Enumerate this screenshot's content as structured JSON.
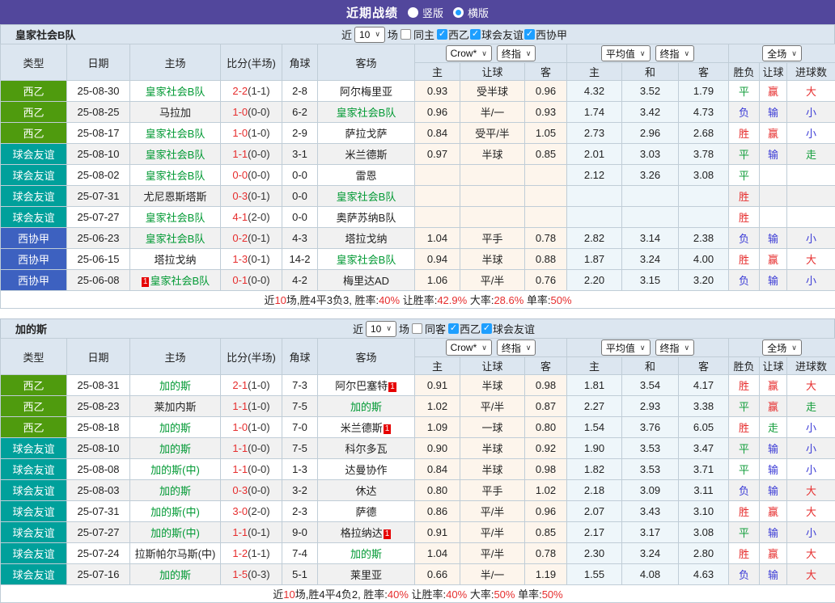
{
  "title": {
    "text": "近期战绩",
    "options": [
      {
        "label": "竖版",
        "checked": false
      },
      {
        "label": "横版",
        "checked": true
      }
    ]
  },
  "columns": {
    "type": "类型",
    "date": "日期",
    "home": "主场",
    "score": "比分(半场)",
    "corner": "角球",
    "away": "客场",
    "h": "主",
    "handicap": "让球",
    "a": "客",
    "draw": "和",
    "wl": "胜负",
    "goals": "进球数"
  },
  "dropdowns": {
    "odds_src": "Crow*",
    "final": "终指",
    "avg": "平均值",
    "scope": "全场"
  },
  "filter_words": {
    "near": "近",
    "count": "10",
    "games": "场"
  },
  "colors": {
    "topbar": "#52479c",
    "league_green": "#4f9b0e",
    "league_teal": "#00a09b",
    "league_blue": "#3d61c0",
    "team_highlight": "#009933",
    "score_red": "#e62e2e",
    "check_blue": "#1e9fff"
  },
  "tables": [
    {
      "team": "皇家社会B队",
      "same": {
        "label": "同主",
        "checked": false
      },
      "leagues": [
        {
          "label": "西乙",
          "checked": true
        },
        {
          "label": "球会友谊",
          "checked": true
        },
        {
          "label": "西协甲",
          "checked": true
        }
      ],
      "rows": [
        {
          "lg": "西乙",
          "lc": "g",
          "date": "25-08-30",
          "home": {
            "n": "皇家社会B队",
            "g": true
          },
          "score": "2-2",
          "half": "(1-1)",
          "corner": "2-8",
          "away": {
            "n": "阿尔梅里亚"
          },
          "odds": [
            "0.93",
            "受半球",
            "0.96"
          ],
          "avg": [
            "4.32",
            "3.52",
            "1.79"
          ],
          "res": [
            [
              "平",
              "g"
            ],
            [
              "赢",
              "r"
            ],
            [
              "大",
              "r"
            ]
          ]
        },
        {
          "lg": "西乙",
          "lc": "g",
          "date": "25-08-25",
          "home": {
            "n": "马拉加"
          },
          "score": "1-0",
          "half": "(0-0)",
          "corner": "6-2",
          "away": {
            "n": "皇家社会B队",
            "g": true
          },
          "odds": [
            "0.96",
            "半/一",
            "0.93"
          ],
          "avg": [
            "1.74",
            "3.42",
            "4.73"
          ],
          "res": [
            [
              "负",
              "b"
            ],
            [
              "输",
              "b"
            ],
            [
              "小",
              "b"
            ]
          ]
        },
        {
          "lg": "西乙",
          "lc": "g",
          "date": "25-08-17",
          "home": {
            "n": "皇家社会B队",
            "g": true
          },
          "score": "1-0",
          "half": "(1-0)",
          "corner": "2-9",
          "away": {
            "n": "萨拉戈萨"
          },
          "odds": [
            "0.84",
            "受平/半",
            "1.05"
          ],
          "avg": [
            "2.73",
            "2.96",
            "2.68"
          ],
          "res": [
            [
              "胜",
              "r"
            ],
            [
              "赢",
              "r"
            ],
            [
              "小",
              "b"
            ]
          ]
        },
        {
          "lg": "球会友谊",
          "lc": "t",
          "date": "25-08-10",
          "home": {
            "n": "皇家社会B队",
            "g": true
          },
          "score": "1-1",
          "half": "(0-0)",
          "corner": "3-1",
          "away": {
            "n": "米兰德斯"
          },
          "odds": [
            "0.97",
            "半球",
            "0.85"
          ],
          "avg": [
            "2.01",
            "3.03",
            "3.78"
          ],
          "res": [
            [
              "平",
              "g"
            ],
            [
              "输",
              "b"
            ],
            [
              "走",
              "g"
            ]
          ]
        },
        {
          "lg": "球会友谊",
          "lc": "t",
          "date": "25-08-02",
          "home": {
            "n": "皇家社会B队",
            "g": true
          },
          "score": "0-0",
          "half": "(0-0)",
          "corner": "0-0",
          "away": {
            "n": "雷恩"
          },
          "odds": [
            "",
            "",
            ""
          ],
          "avg": [
            "2.12",
            "3.26",
            "3.08"
          ],
          "res": [
            [
              "平",
              "g"
            ],
            [
              "",
              ""
            ],
            [
              "",
              ""
            ]
          ]
        },
        {
          "lg": "球会友谊",
          "lc": "t",
          "date": "25-07-31",
          "home": {
            "n": "尤尼恩斯塔斯"
          },
          "score": "0-3",
          "half": "(0-1)",
          "corner": "0-0",
          "away": {
            "n": "皇家社会B队",
            "g": true
          },
          "odds": [
            "",
            "",
            ""
          ],
          "avg": [
            "",
            "",
            ""
          ],
          "res": [
            [
              "胜",
              "r"
            ],
            [
              "",
              ""
            ],
            [
              "",
              ""
            ]
          ]
        },
        {
          "lg": "球会友谊",
          "lc": "t",
          "date": "25-07-27",
          "home": {
            "n": "皇家社会B队",
            "g": true
          },
          "score": "4-1",
          "half": "(2-0)",
          "corner": "0-0",
          "away": {
            "n": "奥萨苏纳B队"
          },
          "odds": [
            "",
            "",
            ""
          ],
          "avg": [
            "",
            "",
            ""
          ],
          "res": [
            [
              "胜",
              "r"
            ],
            [
              "",
              ""
            ],
            [
              "",
              ""
            ]
          ]
        },
        {
          "lg": "西协甲",
          "lc": "b",
          "date": "25-06-23",
          "home": {
            "n": "皇家社会B队",
            "g": true
          },
          "score": "0-2",
          "half": "(0-1)",
          "corner": "4-3",
          "away": {
            "n": "塔拉戈纳"
          },
          "odds": [
            "1.04",
            "平手",
            "0.78"
          ],
          "avg": [
            "2.82",
            "3.14",
            "2.38"
          ],
          "res": [
            [
              "负",
              "b"
            ],
            [
              "输",
              "b"
            ],
            [
              "小",
              "b"
            ]
          ]
        },
        {
          "lg": "西协甲",
          "lc": "b",
          "date": "25-06-15",
          "home": {
            "n": "塔拉戈纳"
          },
          "score": "1-3",
          "half": "(0-1)",
          "corner": "14-2",
          "away": {
            "n": "皇家社会B队",
            "g": true
          },
          "odds": [
            "0.94",
            "半球",
            "0.88"
          ],
          "avg": [
            "1.87",
            "3.24",
            "4.00"
          ],
          "res": [
            [
              "胜",
              "r"
            ],
            [
              "赢",
              "r"
            ],
            [
              "大",
              "r"
            ]
          ]
        },
        {
          "lg": "西协甲",
          "lc": "b",
          "date": "25-06-08",
          "home": {
            "n": "皇家社会B队",
            "g": true,
            "rc": "pre"
          },
          "score": "0-1",
          "half": "(0-0)",
          "corner": "4-2",
          "away": {
            "n": "梅里达AD"
          },
          "odds": [
            "1.06",
            "平/半",
            "0.76"
          ],
          "avg": [
            "2.20",
            "3.15",
            "3.20"
          ],
          "res": [
            [
              "负",
              "b"
            ],
            [
              "输",
              "b"
            ],
            [
              "小",
              "b"
            ]
          ]
        }
      ],
      "summary": [
        [
          "近",
          "k"
        ],
        [
          "10",
          "r"
        ],
        [
          "场,胜4平3负3, 胜率:",
          "k"
        ],
        [
          "40%",
          "r"
        ],
        [
          " 让胜率:",
          "k"
        ],
        [
          "42.9%",
          "r"
        ],
        [
          " 大率:",
          "k"
        ],
        [
          "28.6%",
          "r"
        ],
        [
          " 单率:",
          "k"
        ],
        [
          "50%",
          "r"
        ]
      ]
    },
    {
      "team": "加的斯",
      "same": {
        "label": "同客",
        "checked": false
      },
      "leagues": [
        {
          "label": "西乙",
          "checked": true
        },
        {
          "label": "球会友谊",
          "checked": true
        }
      ],
      "rows": [
        {
          "lg": "西乙",
          "lc": "g",
          "date": "25-08-31",
          "home": {
            "n": "加的斯",
            "g": true
          },
          "score": "2-1",
          "half": "(1-0)",
          "corner": "7-3",
          "away": {
            "n": "阿尔巴塞特",
            "rc": "post"
          },
          "odds": [
            "0.91",
            "半球",
            "0.98"
          ],
          "avg": [
            "1.81",
            "3.54",
            "4.17"
          ],
          "res": [
            [
              "胜",
              "r"
            ],
            [
              "赢",
              "r"
            ],
            [
              "大",
              "r"
            ]
          ]
        },
        {
          "lg": "西乙",
          "lc": "g",
          "date": "25-08-23",
          "home": {
            "n": "莱加内斯"
          },
          "score": "1-1",
          "half": "(1-0)",
          "corner": "7-5",
          "away": {
            "n": "加的斯",
            "g": true
          },
          "odds": [
            "1.02",
            "平/半",
            "0.87"
          ],
          "avg": [
            "2.27",
            "2.93",
            "3.38"
          ],
          "res": [
            [
              "平",
              "g"
            ],
            [
              "赢",
              "r"
            ],
            [
              "走",
              "g"
            ]
          ]
        },
        {
          "lg": "西乙",
          "lc": "g",
          "date": "25-08-18",
          "home": {
            "n": "加的斯",
            "g": true
          },
          "score": "1-0",
          "half": "(1-0)",
          "corner": "7-0",
          "away": {
            "n": "米兰德斯",
            "rc": "post"
          },
          "odds": [
            "1.09",
            "一球",
            "0.80"
          ],
          "avg": [
            "1.54",
            "3.76",
            "6.05"
          ],
          "res": [
            [
              "胜",
              "r"
            ],
            [
              "走",
              "g"
            ],
            [
              "小",
              "b"
            ]
          ]
        },
        {
          "lg": "球会友谊",
          "lc": "t",
          "date": "25-08-10",
          "home": {
            "n": "加的斯",
            "g": true
          },
          "score": "1-1",
          "half": "(0-0)",
          "corner": "7-5",
          "away": {
            "n": "科尔多瓦"
          },
          "odds": [
            "0.90",
            "半球",
            "0.92"
          ],
          "avg": [
            "1.90",
            "3.53",
            "3.47"
          ],
          "res": [
            [
              "平",
              "g"
            ],
            [
              "输",
              "b"
            ],
            [
              "小",
              "b"
            ]
          ]
        },
        {
          "lg": "球会友谊",
          "lc": "t",
          "date": "25-08-08",
          "home": {
            "n": "加的斯(中)",
            "g": true
          },
          "score": "1-1",
          "half": "(0-0)",
          "corner": "1-3",
          "away": {
            "n": "达曼协作"
          },
          "odds": [
            "0.84",
            "半球",
            "0.98"
          ],
          "avg": [
            "1.82",
            "3.53",
            "3.71"
          ],
          "res": [
            [
              "平",
              "g"
            ],
            [
              "输",
              "b"
            ],
            [
              "小",
              "b"
            ]
          ]
        },
        {
          "lg": "球会友谊",
          "lc": "t",
          "date": "25-08-03",
          "home": {
            "n": "加的斯",
            "g": true
          },
          "score": "0-3",
          "half": "(0-0)",
          "corner": "3-2",
          "away": {
            "n": "休达"
          },
          "odds": [
            "0.80",
            "平手",
            "1.02"
          ],
          "avg": [
            "2.18",
            "3.09",
            "3.11"
          ],
          "res": [
            [
              "负",
              "b"
            ],
            [
              "输",
              "b"
            ],
            [
              "大",
              "r"
            ]
          ]
        },
        {
          "lg": "球会友谊",
          "lc": "t",
          "date": "25-07-31",
          "home": {
            "n": "加的斯(中)",
            "g": true
          },
          "score": "3-0",
          "half": "(2-0)",
          "corner": "2-3",
          "away": {
            "n": "萨德"
          },
          "odds": [
            "0.86",
            "平/半",
            "0.96"
          ],
          "avg": [
            "2.07",
            "3.43",
            "3.10"
          ],
          "res": [
            [
              "胜",
              "r"
            ],
            [
              "赢",
              "r"
            ],
            [
              "大",
              "r"
            ]
          ]
        },
        {
          "lg": "球会友谊",
          "lc": "t",
          "date": "25-07-27",
          "home": {
            "n": "加的斯(中)",
            "g": true
          },
          "score": "1-1",
          "half": "(0-1)",
          "corner": "9-0",
          "away": {
            "n": "格拉纳达",
            "rc": "post"
          },
          "odds": [
            "0.91",
            "平/半",
            "0.85"
          ],
          "avg": [
            "2.17",
            "3.17",
            "3.08"
          ],
          "res": [
            [
              "平",
              "g"
            ],
            [
              "输",
              "b"
            ],
            [
              "小",
              "b"
            ]
          ]
        },
        {
          "lg": "球会友谊",
          "lc": "t",
          "date": "25-07-24",
          "home": {
            "n": "拉斯帕尔马斯(中)"
          },
          "score": "1-2",
          "half": "(1-1)",
          "corner": "7-4",
          "away": {
            "n": "加的斯",
            "g": true
          },
          "odds": [
            "1.04",
            "平/半",
            "0.78"
          ],
          "avg": [
            "2.30",
            "3.24",
            "2.80"
          ],
          "res": [
            [
              "胜",
              "r"
            ],
            [
              "赢",
              "r"
            ],
            [
              "大",
              "r"
            ]
          ]
        },
        {
          "lg": "球会友谊",
          "lc": "t",
          "date": "25-07-16",
          "home": {
            "n": "加的斯",
            "g": true
          },
          "score": "1-5",
          "half": "(0-3)",
          "corner": "5-1",
          "away": {
            "n": "莱里亚"
          },
          "odds": [
            "0.66",
            "半/一",
            "1.19"
          ],
          "avg": [
            "1.55",
            "4.08",
            "4.63"
          ],
          "res": [
            [
              "负",
              "b"
            ],
            [
              "输",
              "b"
            ],
            [
              "大",
              "r"
            ]
          ]
        }
      ],
      "summary": [
        [
          "近",
          "k"
        ],
        [
          "10",
          "r"
        ],
        [
          "场,胜4平4负2, 胜率:",
          "k"
        ],
        [
          "40%",
          "r"
        ],
        [
          " 让胜率:",
          "k"
        ],
        [
          "40%",
          "r"
        ],
        [
          " 大率:",
          "k"
        ],
        [
          "50%",
          "r"
        ],
        [
          " 单率:",
          "k"
        ],
        [
          "50%",
          "r"
        ]
      ]
    }
  ]
}
